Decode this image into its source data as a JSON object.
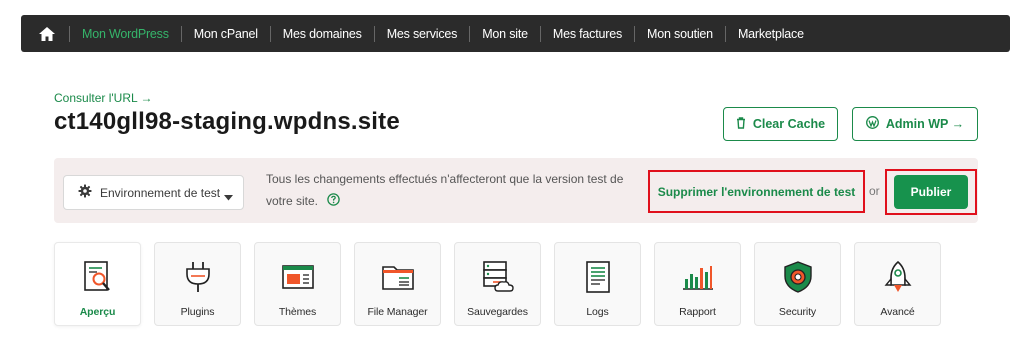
{
  "nav": {
    "home_icon": "home-icon",
    "items": [
      {
        "label": "Mon WordPress",
        "active": true
      },
      {
        "label": "Mon cPanel",
        "active": false
      },
      {
        "label": "Mes domaines",
        "active": false
      },
      {
        "label": "Mes services",
        "active": false
      },
      {
        "label": "Mon site",
        "active": false
      },
      {
        "label": "Mes factures",
        "active": false
      },
      {
        "label": "Mon soutien",
        "active": false
      },
      {
        "label": "Marketplace",
        "active": false
      }
    ]
  },
  "header": {
    "url_link": "Consulter l'URL →",
    "site_title": "ct140gll98-staging.wpdns.site",
    "clear_cache": "Clear Cache",
    "admin_wp": "Admin WP →"
  },
  "staging": {
    "env_select": "Environnement de test",
    "message": "Tous les changements effectués n'affecteront que la version test de votre site.",
    "delete_label": "Supprimer l'environnement de test",
    "or_label": "or",
    "publish_label": "Publier"
  },
  "tiles": [
    {
      "label": "Aperçu",
      "icon": "overview-icon",
      "active": true
    },
    {
      "label": "Plugins",
      "icon": "plug-icon",
      "active": false
    },
    {
      "label": "Thèmes",
      "icon": "theme-icon",
      "active": false
    },
    {
      "label": "File Manager",
      "icon": "folder-icon",
      "active": false
    },
    {
      "label": "Sauvegardes",
      "icon": "backup-icon",
      "active": false
    },
    {
      "label": "Logs",
      "icon": "logs-icon",
      "active": false
    },
    {
      "label": "Rapport",
      "icon": "report-icon",
      "active": false
    },
    {
      "label": "Security",
      "icon": "security-icon",
      "active": false
    },
    {
      "label": "Avancé",
      "icon": "rocket-icon",
      "active": false
    }
  ],
  "colors": {
    "accent_green": "#1b8a4a",
    "nav_bg": "#2b2b2b",
    "highlight_red": "#e0101c",
    "icon_orange": "#f0562a"
  }
}
